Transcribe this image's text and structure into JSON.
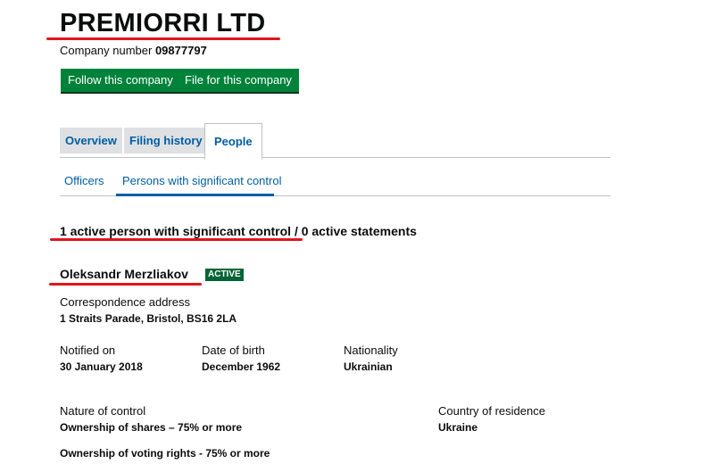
{
  "company": {
    "name": "PREMIORRI LTD",
    "number_label": "Company number",
    "number": "09877797"
  },
  "actions": {
    "follow_label": "Follow this company",
    "file_label": "File for this company"
  },
  "tabs": [
    {
      "label": "Overview",
      "active": false
    },
    {
      "label": "Filing history",
      "active": false
    },
    {
      "label": "People",
      "active": true
    }
  ],
  "subtabs": [
    {
      "label": "Officers",
      "active": false
    },
    {
      "label": "Persons with significant control",
      "active": true
    }
  ],
  "summary": "1 active person with significant control / 0 active statements",
  "person": {
    "name": "Oleksandr Merzliakov",
    "status": "ACTIVE",
    "correspondence_label": "Correspondence address",
    "correspondence_value": "1 Straits Parade, Bristol, BS16 2LA",
    "notified_label": "Notified on",
    "notified_value": "30 January 2018",
    "dob_label": "Date of birth",
    "dob_value": "December 1962",
    "nationality_label": "Nationality",
    "nationality_value": "Ukrainian",
    "nature_label": "Nature of control",
    "nature_values": [
      "Ownership of shares – 75% or more",
      "Ownership of voting rights - 75% or more"
    ],
    "residence_label": "Country of residence",
    "residence_value": "Ukraine"
  },
  "colors": {
    "button_green": "#00823b",
    "link_blue": "#005ea5",
    "annotation_red": "#e1151d",
    "badge_green": "#006435"
  }
}
